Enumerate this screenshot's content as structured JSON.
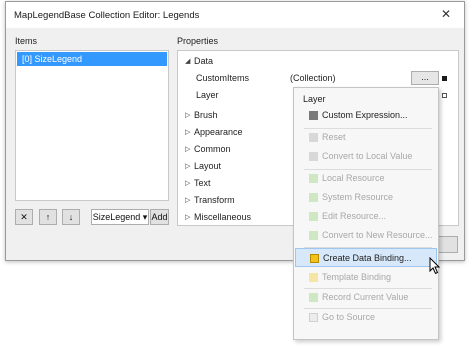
{
  "window": {
    "title": "MapLegendBase Collection Editor: Legends",
    "close_glyph": "✕"
  },
  "items_panel": {
    "label": "Items",
    "items": [
      "[0] SizeLegend"
    ],
    "buttons": {
      "remove": "✕",
      "up": "↑",
      "down": "↓",
      "type_select": "SizeLegend ▾",
      "add": "Add"
    }
  },
  "properties_panel": {
    "label": "Properties",
    "rows": [
      {
        "kind": "category",
        "arrow": "◢",
        "name": "Data"
      },
      {
        "kind": "property",
        "name": "CustomItems",
        "value": "(Collection)",
        "button": "..."
      },
      {
        "kind": "property",
        "name": "Layer",
        "value": "",
        "button": ""
      },
      {
        "kind": "category",
        "arrow": "▷",
        "name": "Brush"
      },
      {
        "kind": "category",
        "arrow": "▷",
        "name": "Appearance"
      },
      {
        "kind": "category",
        "arrow": "▷",
        "name": "Common"
      },
      {
        "kind": "category",
        "arrow": "▷",
        "name": "Layout"
      },
      {
        "kind": "category",
        "arrow": "▷",
        "name": "Text"
      },
      {
        "kind": "category",
        "arrow": "▷",
        "name": "Transform"
      },
      {
        "kind": "category",
        "arrow": "▷",
        "name": "Miscellaneous"
      }
    ]
  },
  "context_menu": {
    "header": "Layer",
    "items": [
      {
        "label": "Custom Expression...",
        "enabled": true,
        "icon": "gray-square-icon",
        "icon_color": "#7a7a7a"
      },
      {
        "label": "Reset",
        "enabled": false,
        "icon": "disabled-square-icon",
        "icon_color": "#d8d8d8"
      },
      {
        "label": "Convert to Local Value",
        "enabled": false,
        "icon": "disabled-square-icon",
        "icon_color": "#d8d8d8"
      },
      {
        "label": "Local Resource",
        "enabled": false,
        "icon": "green-square-icon",
        "icon_color": "#cfe8c3"
      },
      {
        "label": "System Resource",
        "enabled": false,
        "icon": "green-square-icon",
        "icon_color": "#cfe8c3"
      },
      {
        "label": "Edit Resource...",
        "enabled": false,
        "icon": "green-square-icon",
        "icon_color": "#cfe8c3"
      },
      {
        "label": "Convert to New Resource...",
        "enabled": false,
        "icon": "green-square-icon",
        "icon_color": "#cfe8c3"
      },
      {
        "label": "Create Data Binding...",
        "enabled": true,
        "highlighted": true,
        "icon": "yellow-square-icon",
        "icon_color": "#f2c21b"
      },
      {
        "label": "Template Binding",
        "enabled": false,
        "icon": "yellow-square-icon",
        "icon_color": "#f6e6a6"
      },
      {
        "label": "Record Current Value",
        "enabled": false,
        "icon": "green-square-icon",
        "icon_color": "#cfe8c3"
      },
      {
        "label": "Go to Source",
        "enabled": false,
        "icon": "disabled-square-icon",
        "icon_color": "#ececec"
      }
    ]
  },
  "colors": {
    "selection": "#3399ff",
    "menu_highlight": "#d7e8fa",
    "disabled_text": "#a8a8a8"
  }
}
